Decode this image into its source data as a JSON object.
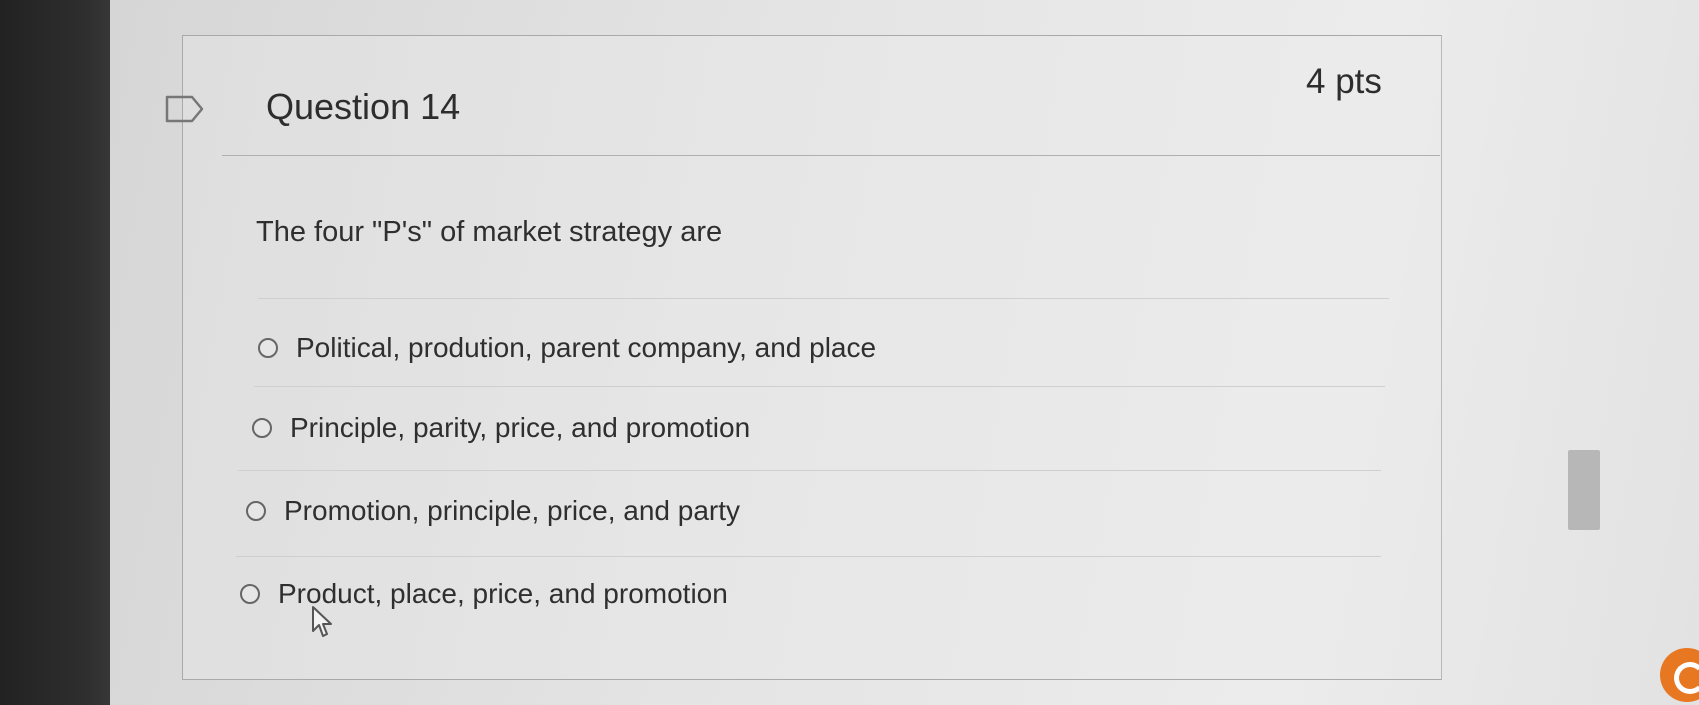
{
  "question": {
    "title": "Question 14",
    "points": "4 pts",
    "text": "The four \"P's\" of market strategy are"
  },
  "answers": [
    {
      "label": "Political, prodution, parent company, and place",
      "selected": false
    },
    {
      "label": "Principle, parity, price, and promotion",
      "selected": false
    },
    {
      "label": "Promotion, principle, price, and party",
      "selected": false
    },
    {
      "label": "Product, place, price, and promotion",
      "selected": false
    }
  ],
  "icons": {
    "flag": "flag-question-icon",
    "cursor": "mouse-pointer-icon"
  },
  "colors": {
    "text": "#2f2f2f",
    "border": "#a9a9a9",
    "accent": "#e87722"
  }
}
